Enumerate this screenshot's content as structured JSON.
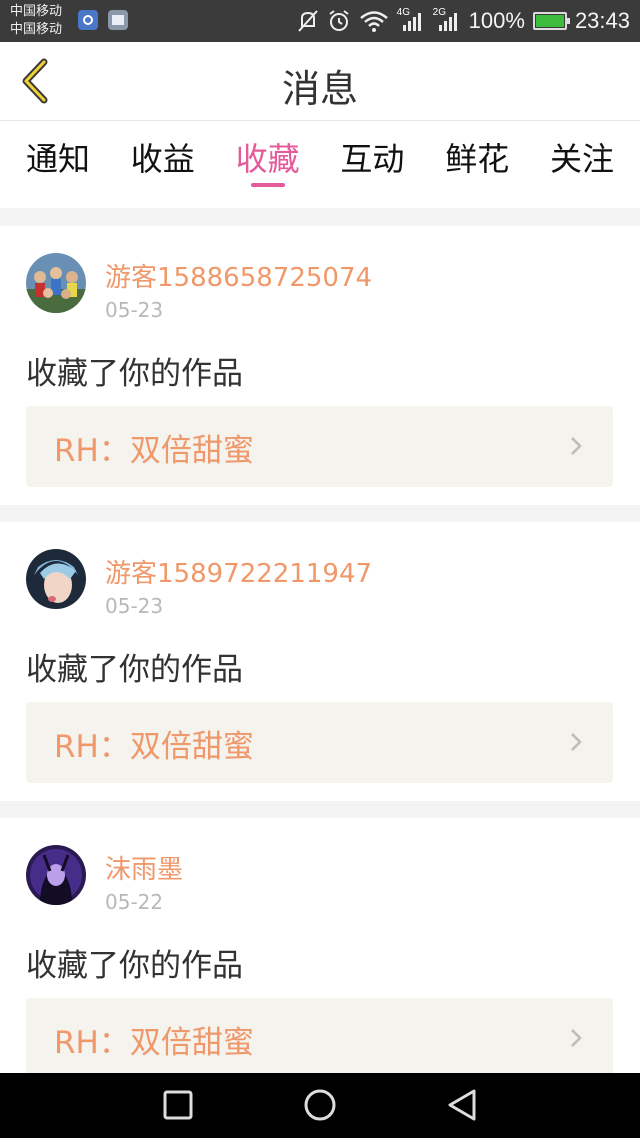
{
  "status_bar": {
    "carrier_1": "中国移动",
    "carrier_2": "中国移动",
    "network_1": "4G",
    "network_2": "2G",
    "battery": "100%",
    "time": "23:43"
  },
  "header": {
    "title": "消息",
    "back_icon": "chevron-left-icon"
  },
  "tabs": [
    {
      "label": "通知",
      "active": false
    },
    {
      "label": "收益",
      "active": false
    },
    {
      "label": "收藏",
      "active": true
    },
    {
      "label": "互动",
      "active": false
    },
    {
      "label": "鲜花",
      "active": false
    },
    {
      "label": "关注",
      "active": false
    }
  ],
  "messages": [
    {
      "username": "游客1588658725074",
      "date": "05-23",
      "action": "收藏了你的作品",
      "work_title": "RH：双倍甜蜜"
    },
    {
      "username": "游客1589722211947",
      "date": "05-23",
      "action": "收藏了你的作品",
      "work_title": "RH：双倍甜蜜"
    },
    {
      "username": "沫雨墨",
      "date": "05-22",
      "action": "收藏了你的作品",
      "work_title": "RH：双倍甜蜜"
    }
  ],
  "colors": {
    "accent_pink": "#e55a9a",
    "name_orange": "#f0986a"
  }
}
